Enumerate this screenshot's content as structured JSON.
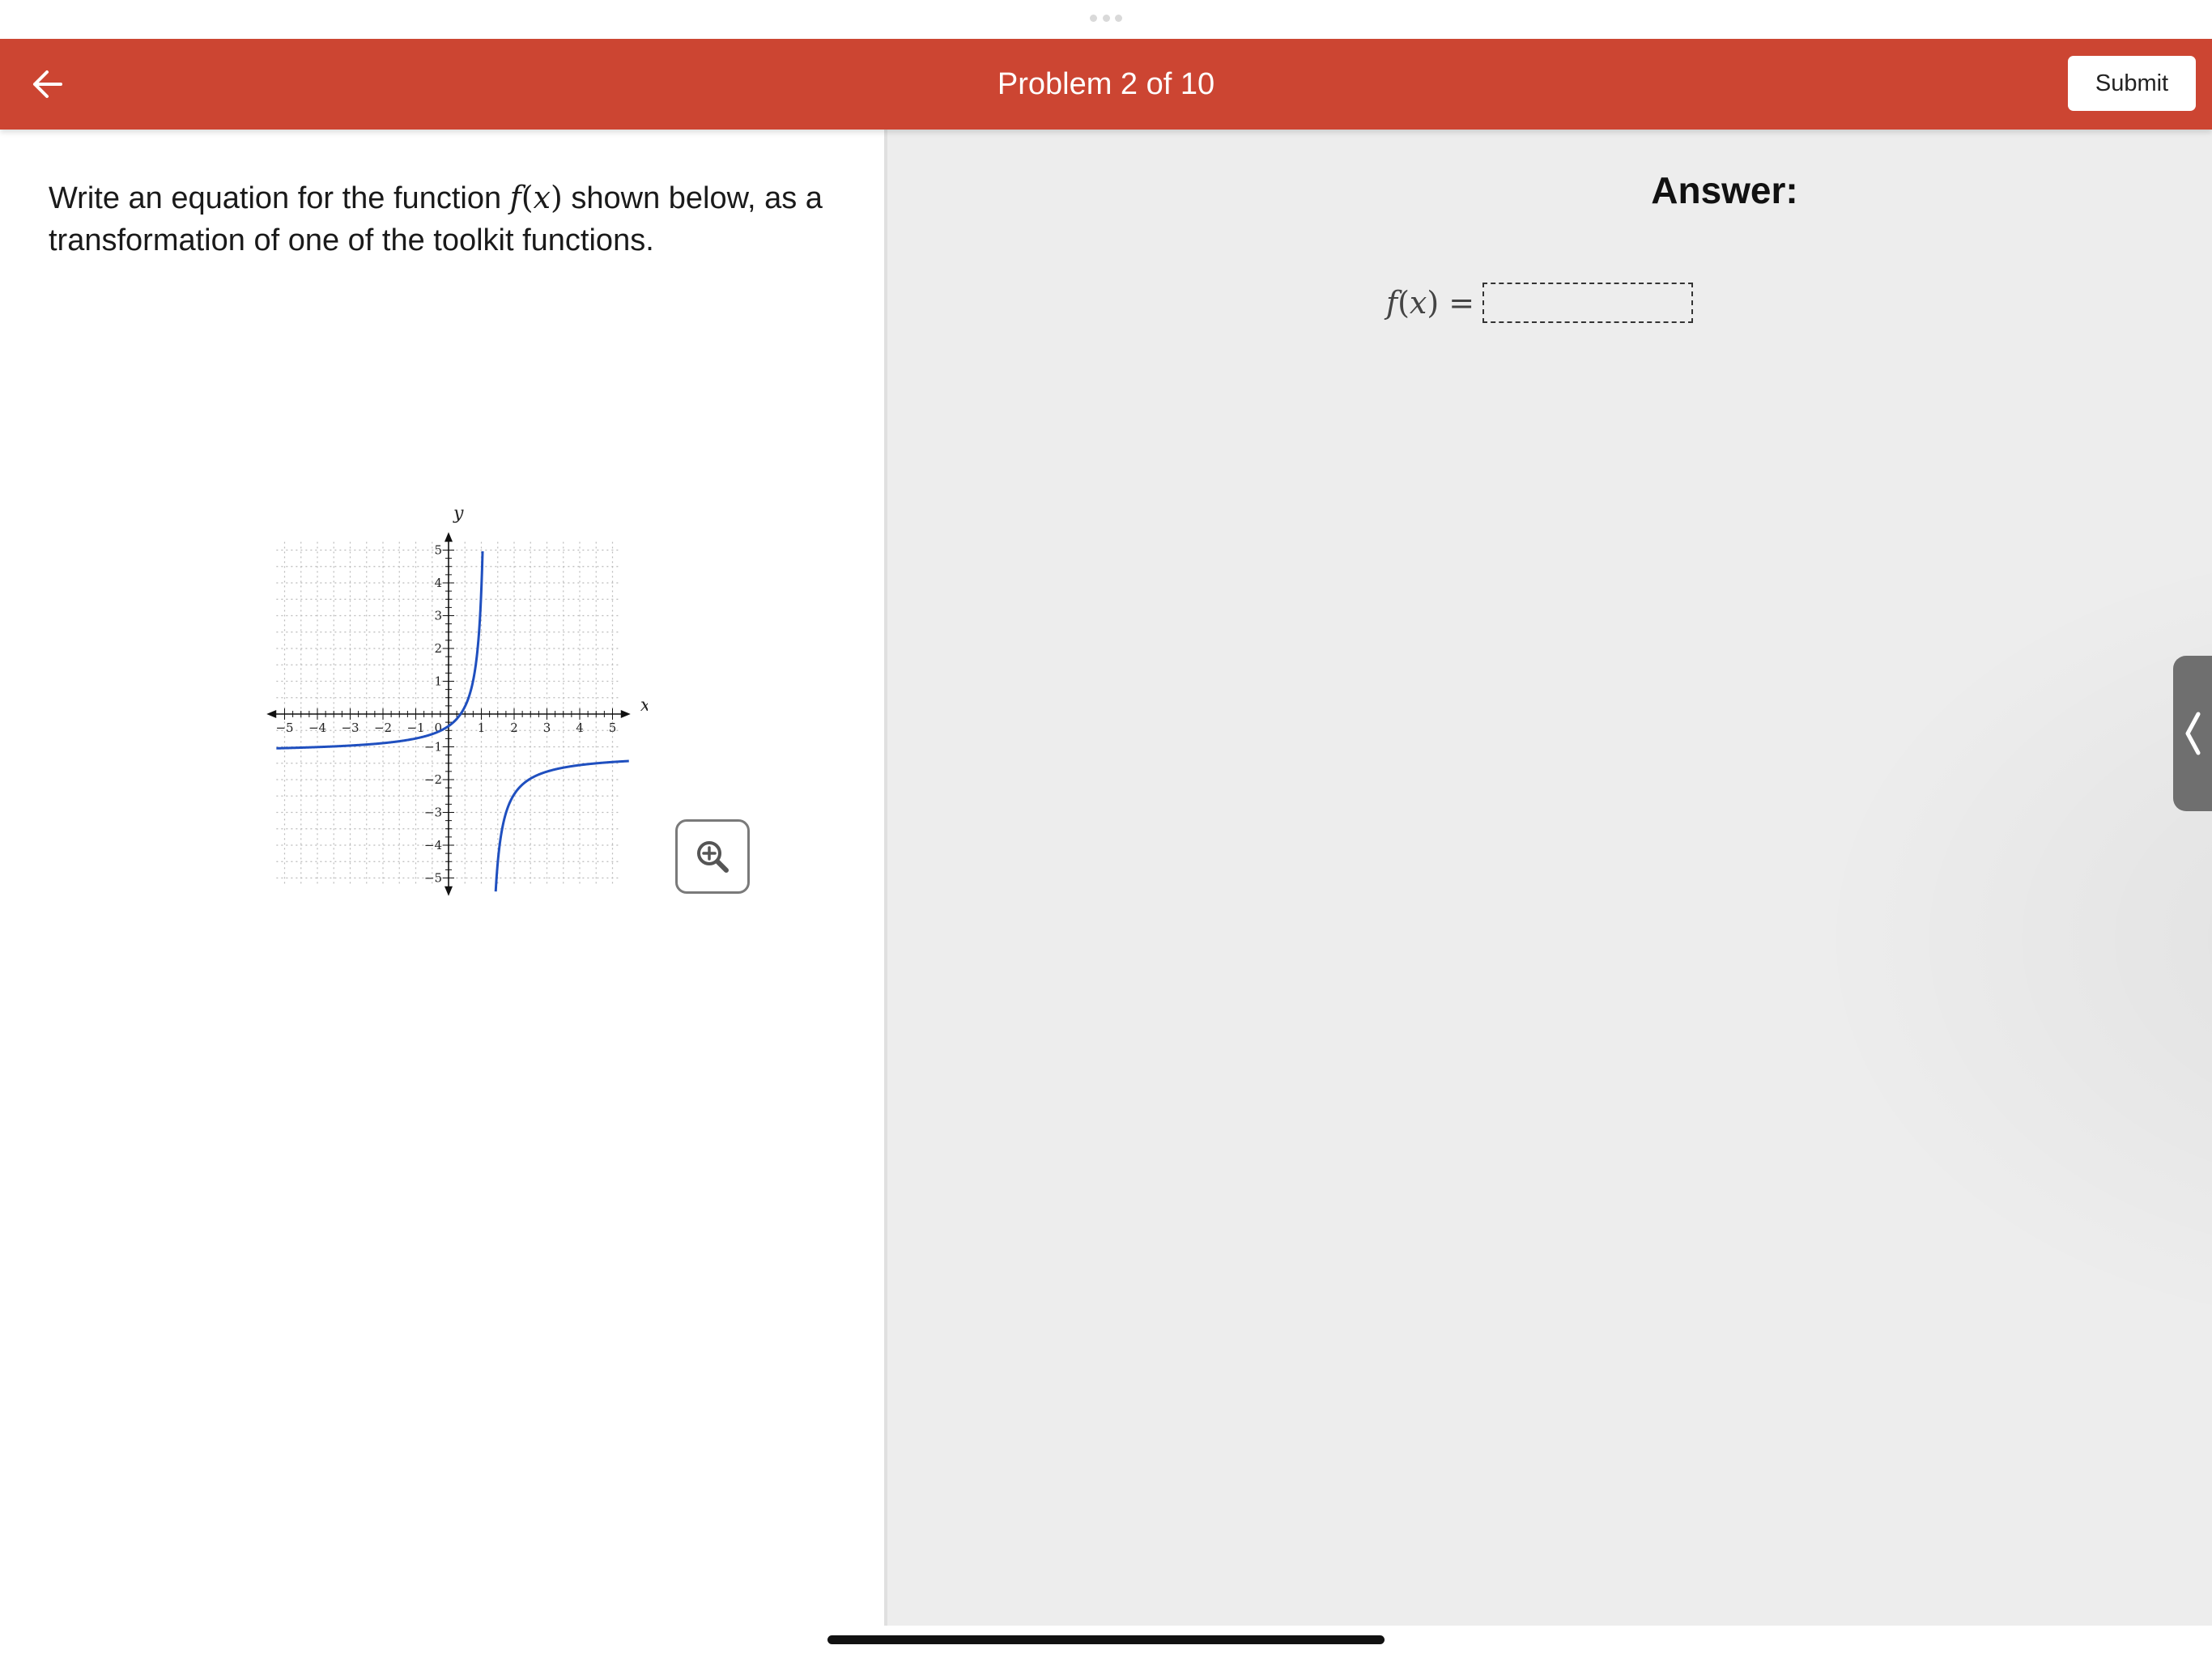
{
  "header": {
    "title": "Problem 2 of 10",
    "submit_label": "Submit",
    "background_color": "#cc4532"
  },
  "question": {
    "text_before": "Write an equation for the function ",
    "func_name": "f",
    "func_open": "(",
    "func_var": "x",
    "func_close": ")",
    "text_after": " shown below, as a transformation of one of the toolkit functions."
  },
  "graph": {
    "x_axis_label": "x",
    "y_axis_label": "y",
    "x_range": [
      -5,
      5
    ],
    "y_range": [
      -5,
      5
    ],
    "x_ticks": [
      "−5",
      "−4",
      "−3",
      "−2",
      "−1",
      "1",
      "2",
      "3",
      "4",
      "5"
    ],
    "y_ticks": [
      "5",
      "4",
      "3",
      "2",
      "1",
      "−1",
      "−2",
      "−3",
      "−4",
      "−5"
    ],
    "origin_label": "0",
    "curve_color": "#1f4fbf",
    "vertical_asymptote_x": 1.2,
    "horizontal_asymptote_y": -1.2
  },
  "answer": {
    "title": "Answer:",
    "label_func": "f",
    "label_open": "(",
    "label_var": "x",
    "label_close": ")",
    "label_eq": " =",
    "input_value": ""
  },
  "icons": {
    "back": "arrow-left-icon",
    "zoom": "zoom-in-icon",
    "side_tab": "chevron-left-icon"
  }
}
